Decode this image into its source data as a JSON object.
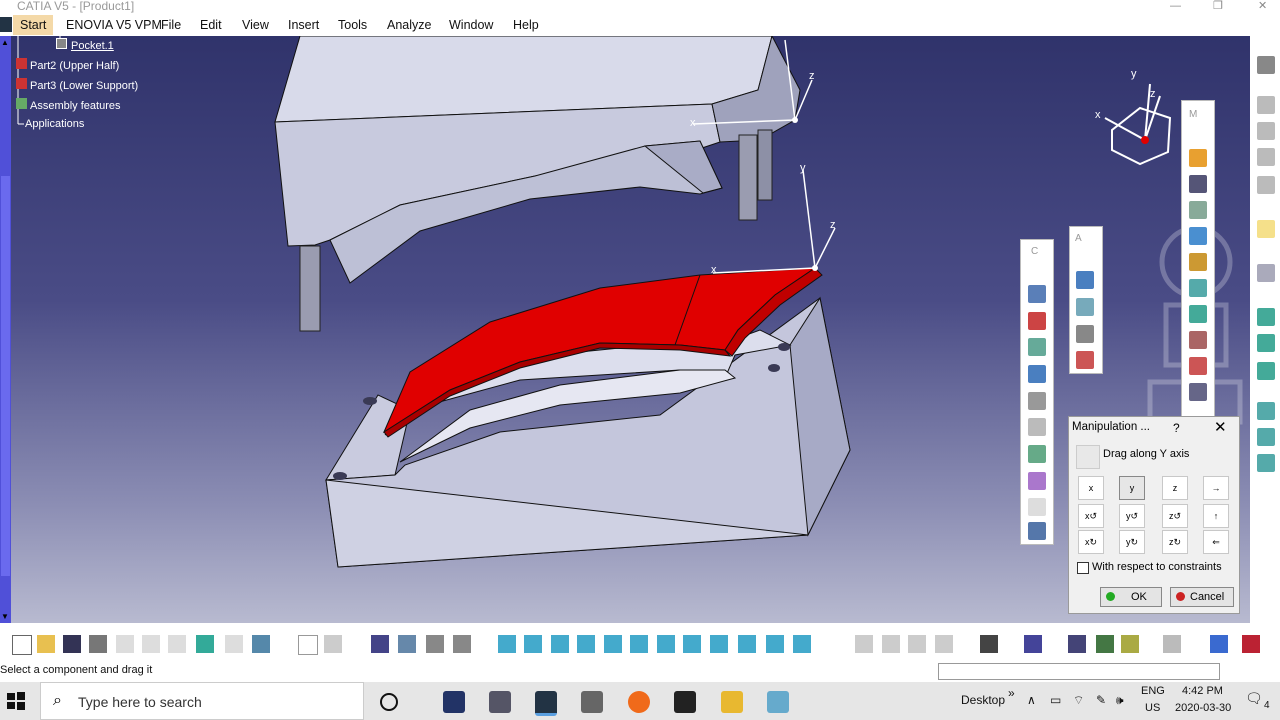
{
  "window": {
    "title": "CATIA V5 - [Product1]"
  },
  "menu": {
    "items": [
      "Start",
      "ENOVIA V5 VPM",
      "File",
      "Edit",
      "View",
      "Insert",
      "Tools",
      "Analyze",
      "Window",
      "Help"
    ]
  },
  "tree": {
    "nodes": [
      "Pocket.1",
      "Part2 (Upper Half)",
      "Part3 (Lower Support)",
      "Assembly features",
      "Applications"
    ]
  },
  "axes": {
    "x": "x",
    "y": "y",
    "z": "z"
  },
  "toolbars": {
    "m_label": "M",
    "a_label": "A",
    "c_label": "C"
  },
  "dialog": {
    "title": "Manipulation ...",
    "help": "?",
    "close": "✕",
    "mode": "Drag along Y axis",
    "grid": [
      "x",
      "y",
      "z",
      "→",
      "x↺",
      "y↺",
      "z↺",
      "↑",
      "x↻",
      "y↻",
      "z↻",
      "⇐"
    ],
    "constraints_label": "With respect to constraints",
    "constraints_checked": false,
    "ok": "OK",
    "cancel": "Cancel"
  },
  "status": {
    "text": "Select a component and drag it"
  },
  "taskbar": {
    "search_placeholder": "Type here to search",
    "desktop": "Desktop",
    "lang1": "ENG",
    "lang2": "US",
    "time": "4:42 PM",
    "date": "2020-03-30",
    "notif": "4"
  },
  "colors": {
    "accent_red": "#e00000",
    "viewport_top": "#30336b",
    "viewport_bottom": "#b8bad0"
  }
}
